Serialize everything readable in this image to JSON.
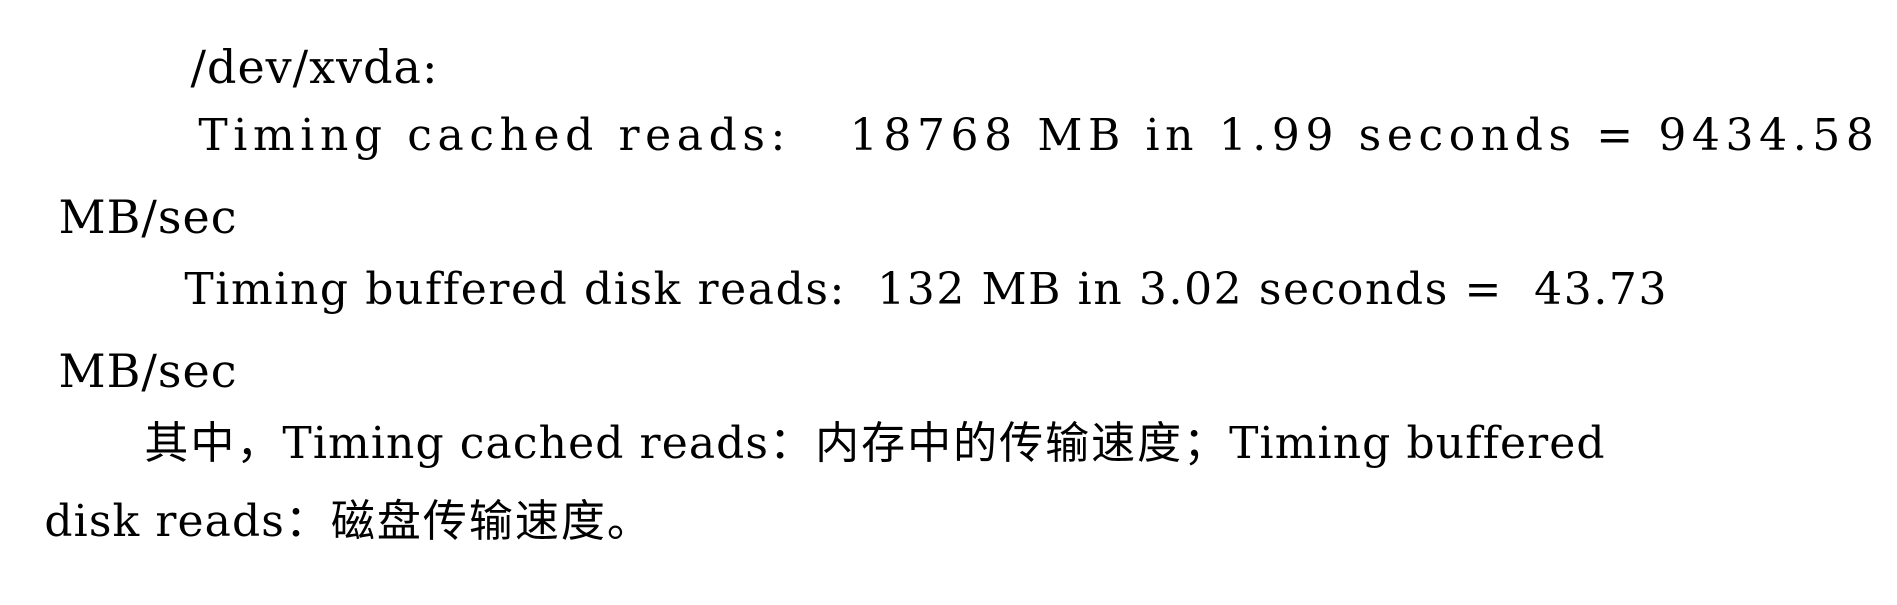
{
  "document": {
    "kind": "scanned-text-page",
    "background_color": "#ffffff",
    "text_color": "#000000",
    "lines": [
      {
        "id": "line-device",
        "text": "/dev/xvda:"
      },
      {
        "id": "line-cached-reads",
        "text": "Timing cached reads:   18768 MB in  1.99 seconds = 9434.58"
      },
      {
        "id": "line-cached-units",
        "text": "MB/sec"
      },
      {
        "id": "line-buffered-reads",
        "text": "Timing buffered disk reads:  132 MB in  3.02 seconds =  43.73"
      },
      {
        "id": "line-buffered-units",
        "text": "MB/sec"
      },
      {
        "id": "line-explanation-part1",
        "text": "其中，Timing cached reads：内存中的传输速度；Timing buffered"
      },
      {
        "id": "line-explanation-part2",
        "text": "disk reads：磁盘传输速度。"
      }
    ]
  },
  "hdparm_output": {
    "device": "/dev/xvda:",
    "cached_reads": {
      "label": "Timing cached reads:",
      "amount": "18768 MB",
      "in_word": "in",
      "duration": "1.99 seconds",
      "equals": "=",
      "rate": "9434.58",
      "rate_units": "MB/sec"
    },
    "buffered_disk_reads": {
      "label": "Timing buffered disk reads:",
      "amount": "132 MB",
      "in_word": "in",
      "duration": "3.02 seconds",
      "equals": "=",
      "rate": "43.73",
      "rate_units": "MB/sec"
    }
  },
  "explanation": {
    "lead_in": "其中，",
    "term_one": "Timing cached reads",
    "sep_one": "：",
    "meaning_one": "内存中的传输速度",
    "semicolon": "；",
    "term_two_head": "Timing buffered",
    "term_two_tail": "disk reads",
    "sep_two": "：",
    "meaning_two": "磁盘传输速度",
    "period": "。"
  },
  "segments": {
    "l1": "/dev/xvda:",
    "l2_a": "Timing cached reads:",
    "l2_b": "18768 MB in",
    "l2_c": "1.99 seconds = 9434.58",
    "l3": "MB/sec",
    "l4_a": "Timing buffered disk reads:",
    "l4_b": "132 MB in",
    "l4_c": "3.02 seconds =",
    "l4_d": "43.73",
    "l5": "MB/sec",
    "l6_a": "其中，",
    "l6_b": "Timing cached reads",
    "l6_c": "：内存中的传输速度；",
    "l6_d": "Timing buffered",
    "l7_a": "disk reads",
    "l7_b": "：磁盘传输速度。"
  }
}
